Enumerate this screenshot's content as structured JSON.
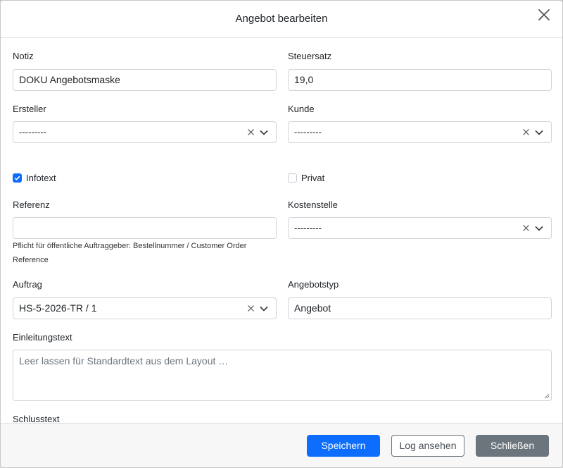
{
  "dialog": {
    "title": "Angebot bearbeiten"
  },
  "form": {
    "notiz": {
      "label": "Notiz",
      "value": "DOKU Angebotsmaske"
    },
    "steuersatz": {
      "label": "Steuersatz",
      "value": "19,0"
    },
    "ersteller": {
      "label": "Ersteller",
      "value": "---------"
    },
    "kunde": {
      "label": "Kunde",
      "value": "---------"
    },
    "infotext": {
      "label": "Infotext",
      "checked": true
    },
    "privat": {
      "label": "Privat",
      "checked": false
    },
    "referenz": {
      "label": "Referenz",
      "value": "",
      "help": "Pflicht für öffentliche Auftraggeber: Bestellnummer / Customer Order Reference"
    },
    "kostenstelle": {
      "label": "Kostenstelle",
      "value": "---------"
    },
    "auftrag": {
      "label": "Auftrag",
      "value": "HS-5-2026-TR / 1"
    },
    "angebotstyp": {
      "label": "Angebotstyp",
      "value": "Angebot"
    },
    "einleitungstext": {
      "label": "Einleitungstext",
      "placeholder": "Leer lassen für Standardtext aus dem Layout …"
    },
    "schlusstext": {
      "label": "Schlusstext"
    }
  },
  "footer": {
    "save_label": "Speichern",
    "log_label": "Log ansehen",
    "close_label": "Schließen"
  },
  "colors": {
    "primary": "#0d6efd",
    "secondary": "#6c757d"
  }
}
